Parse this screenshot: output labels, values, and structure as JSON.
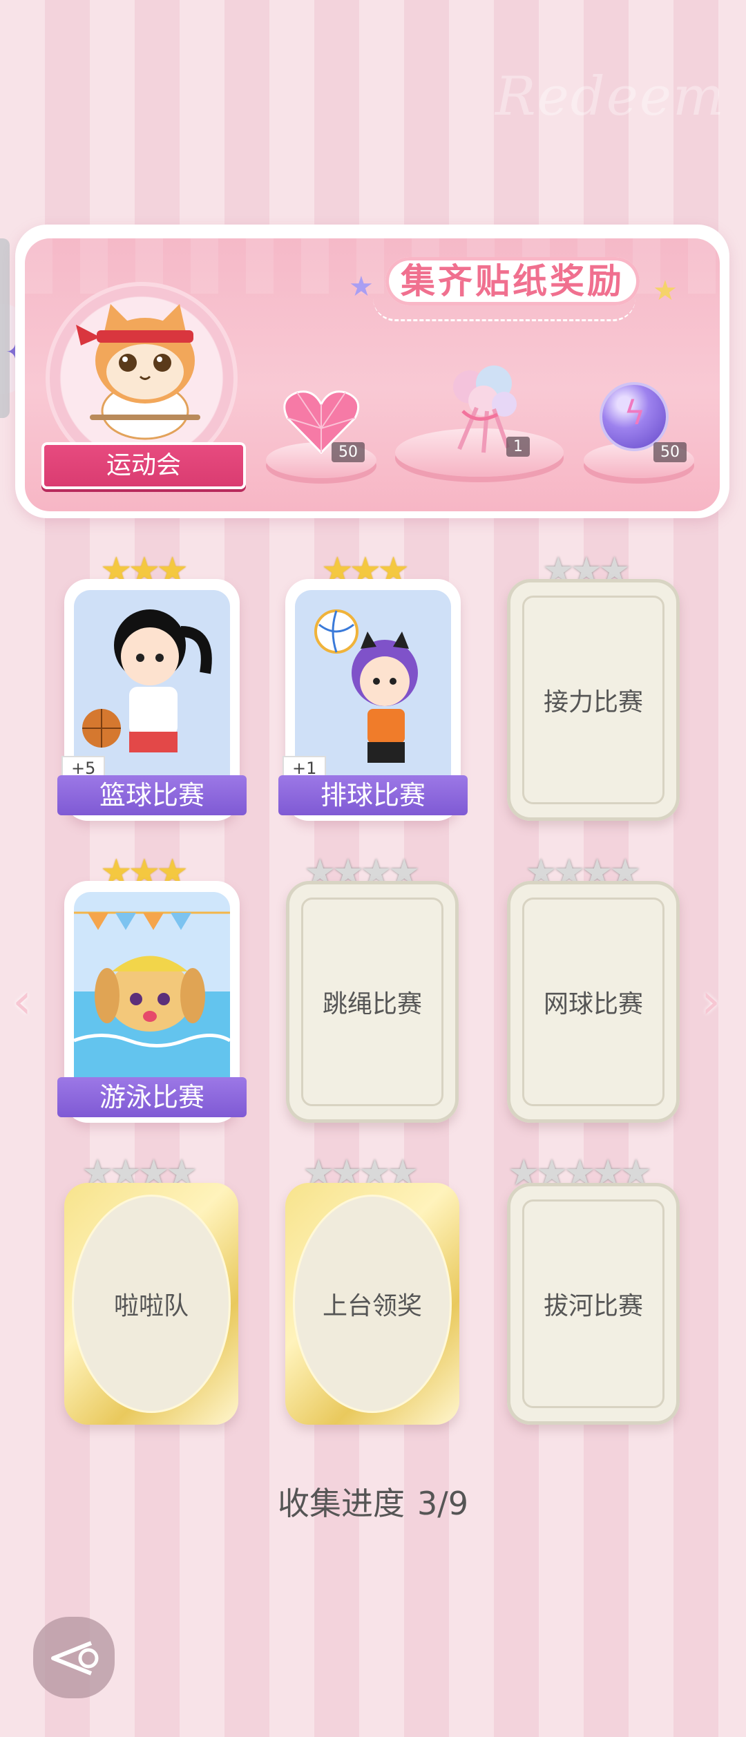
{
  "banner": {
    "title": "集齐贴纸奖励",
    "watermark": "Redeem",
    "event_label": "运动会",
    "rewards": [
      {
        "icon": "pink-heart-gem-icon",
        "count": "50"
      },
      {
        "icon": "flower-bouquet-icon",
        "count": "1"
      },
      {
        "icon": "purple-orb-icon",
        "count": "50"
      }
    ]
  },
  "stickers": [
    {
      "label": "篮球比赛",
      "collected": true,
      "bonus": "+5",
      "stars": 3
    },
    {
      "label": "排球比赛",
      "collected": true,
      "bonus": "+1",
      "stars": 3
    },
    {
      "label": "接力比赛",
      "collected": false,
      "stars": 3
    },
    {
      "label": "游泳比赛",
      "collected": true,
      "stars": 3
    },
    {
      "label": "跳绳比赛",
      "collected": false,
      "stars": 4
    },
    {
      "label": "网球比赛",
      "collected": false,
      "stars": 4
    },
    {
      "label": "啦啦队",
      "collected": false,
      "stars": 4
    },
    {
      "label": "上台领奖",
      "collected": false,
      "stars": 4
    },
    {
      "label": "拔河比赛",
      "collected": false,
      "stars": 5
    }
  ],
  "progress": {
    "label": "收集进度",
    "value": "3/9"
  },
  "nav": {
    "prev": "‹",
    "next": "›"
  },
  "colors": {
    "accent": "#f0708f",
    "label_purple": "#8a66dc",
    "gold_star": "#f4c840"
  }
}
